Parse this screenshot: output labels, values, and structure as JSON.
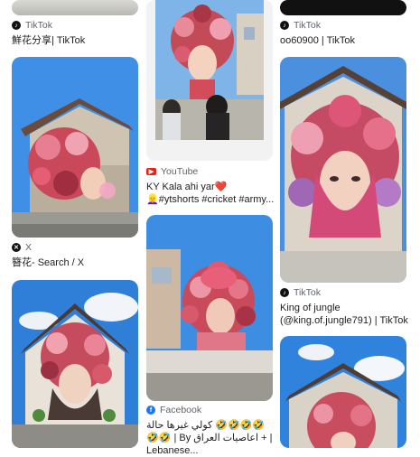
{
  "results": [
    {
      "source": "TikTok",
      "title": "鮮花分享| TikTok"
    },
    {
      "source": "TikTok",
      "title": "oo60900 | TikTok"
    },
    {
      "source": "YouTube",
      "title": "KY Kala ahi yar❤️👱‍♀️#ytshorts #cricket #army..."
    },
    {
      "source": "X",
      "title": "簪花- Search / X"
    },
    {
      "source": "TikTok",
      "title": "King of jungle (@king.of.jungle791) | TikTok"
    },
    {
      "source": "Facebook",
      "title": "كولي غيرها حالة 🤣🤣🤣🤣🤣🤣 | By اعاصيات العراق + | Lebanese..."
    }
  ],
  "icons": {
    "tiktok": "tiktok-icon",
    "youtube": "youtube-icon",
    "x": "x-icon",
    "facebook": "facebook-icon"
  }
}
